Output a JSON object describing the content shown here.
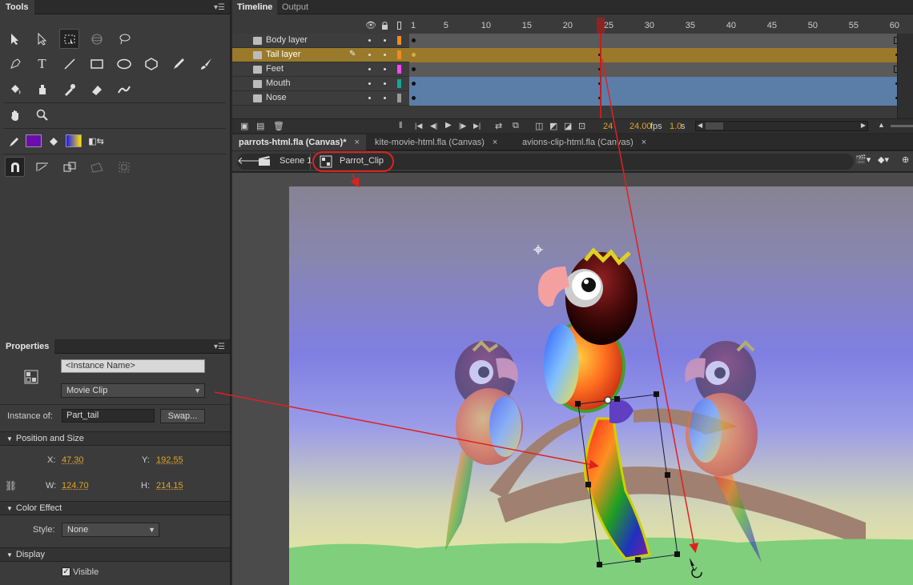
{
  "tools_panel": {
    "title": "Tools",
    "icons": [
      "selection-icon",
      "subselection-icon",
      "free-transform-icon",
      "3d-rotation-icon",
      "lasso-icon",
      "pen-icon",
      "text-icon",
      "line-icon",
      "rectangle-icon",
      "oval-icon",
      "polystar-icon",
      "pencil-icon",
      "brush-icon",
      "paint-bucket-icon",
      "ink-bottle-icon",
      "eyedropper-icon",
      "eraser-icon",
      "bone-icon",
      "hand-icon",
      "zoom-icon",
      "stroke-color-icon",
      "fill-color-icon",
      "swap-colors-icon",
      "snap-to-objects-icon",
      "smooth-icon",
      "straighten-icon",
      "rotate-skew-icon",
      "scale-icon"
    ],
    "stroke_color": "#000000",
    "fill_color": "#6a0dad"
  },
  "properties": {
    "title": "Properties",
    "instance_name_placeholder": "<Instance Name>",
    "symbol_type": "Movie Clip",
    "instance_of_label": "Instance of:",
    "instance_of_value": "Part_tail",
    "swap_label": "Swap...",
    "position_section": "Position and Size",
    "x_label": "X:",
    "x_value": "47.30",
    "y_label": "Y:",
    "y_value": "192.55",
    "w_label": "W:",
    "w_value": "124.70",
    "h_label": "H:",
    "h_value": "214.15",
    "color_section": "Color Effect",
    "style_label": "Style:",
    "style_value": "None",
    "display_section": "Display",
    "visible_label": "Visible"
  },
  "timeline": {
    "tabs": [
      "Timeline",
      "Output"
    ],
    "frame_numbers": [
      "1",
      "5",
      "10",
      "15",
      "20",
      "25",
      "30",
      "35",
      "40",
      "45",
      "50",
      "55",
      "60"
    ],
    "layers": [
      {
        "name": "Body layer",
        "color": "#f08a24"
      },
      {
        "name": "Tail layer",
        "color": "#f08a24"
      },
      {
        "name": "Feet",
        "color": "#ff44ff"
      },
      {
        "name": "Mouth",
        "color": "#16a59a"
      },
      {
        "name": "Nose",
        "color": "#999999"
      }
    ],
    "current_frame": "24",
    "fps": "24.00",
    "fps_unit": "fps",
    "time": "1.0",
    "time_unit": "s"
  },
  "documents": {
    "tabs": [
      {
        "label": "parrots-html.fla (Canvas)*"
      },
      {
        "label": "kite-movie-html.fla (Canvas)"
      },
      {
        "label": "avions-clip-html.fla (Canvas)"
      }
    ],
    "close_glyph": "×"
  },
  "breadcrumb": {
    "scene": "Scene 1",
    "symbol": "Parrot_Clip"
  },
  "colors": {
    "panel_bg": "#3b3b3b",
    "selected_layer": "#9a7a2a",
    "tween_span": "#5b7ea8",
    "annotation": "#e02020",
    "highlight": "#e1a42c"
  }
}
